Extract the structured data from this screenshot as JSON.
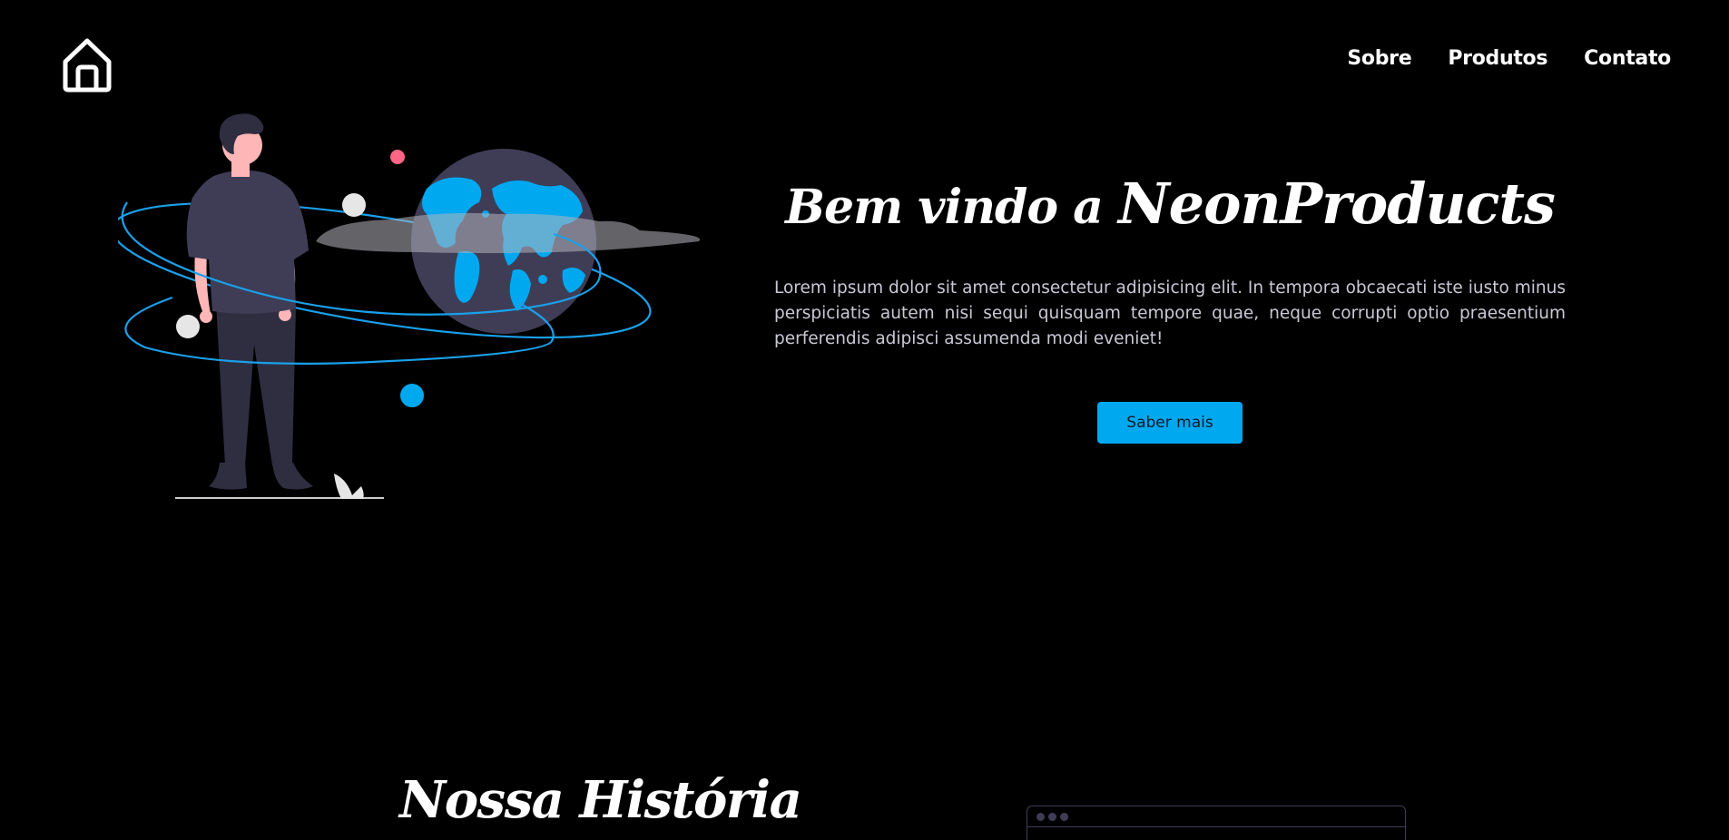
{
  "header": {
    "home_icon": "home-icon",
    "nav": [
      {
        "label": "Sobre"
      },
      {
        "label": "Produtos"
      },
      {
        "label": "Contato"
      }
    ]
  },
  "hero": {
    "title_prefix": "Bem vindo a ",
    "title_brand": "NeonProducts",
    "description": "Lorem ipsum dolor sit amet consectetur adipisicing elit. In tempora obcaecati iste iusto minus perspiciatis autem nisi sequi quisquam tempore quae, neque corrupti optio praesentium perferendis adipisci assumenda modi eveniet!",
    "cta_label": "Saber mais",
    "illustration": "man-with-globe-illustration"
  },
  "history": {
    "title": "Nossa História",
    "illustration": "browser-window-illustration"
  },
  "colors": {
    "background": "#000000",
    "accent": "#00a8f0",
    "text": "#ffffff",
    "muted_text": "#c9c9d6",
    "illustration_dark": "#3f3d56",
    "skin": "#ffb6b6",
    "red_dot": "#ff6584"
  }
}
